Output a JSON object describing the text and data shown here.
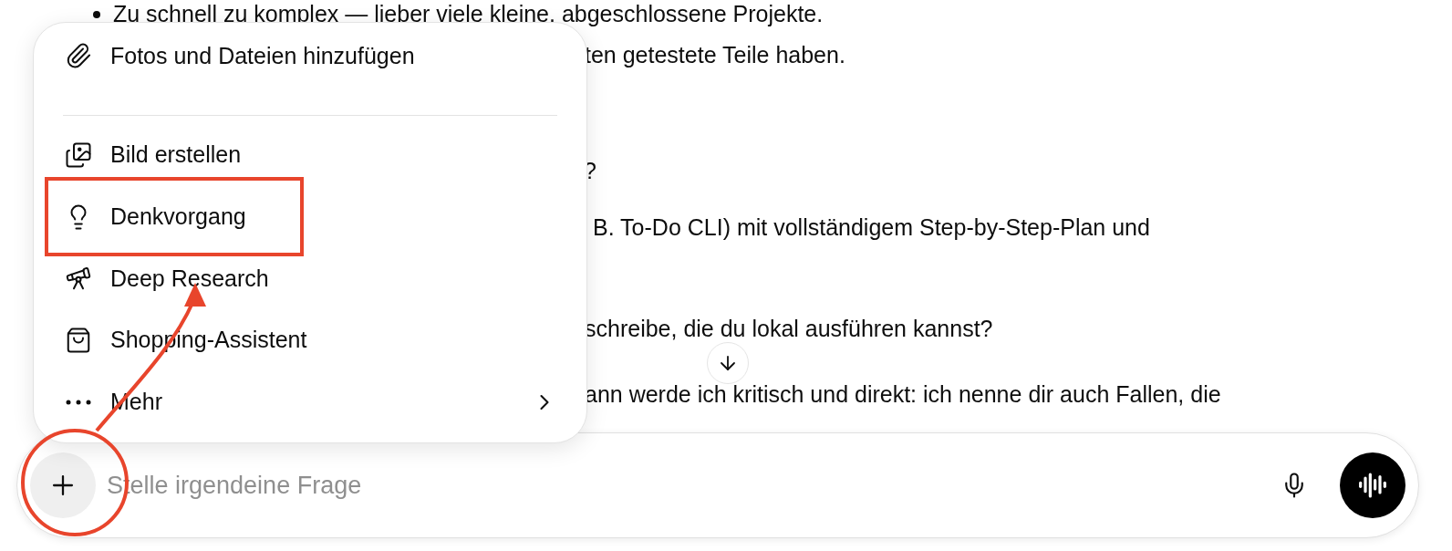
{
  "background_text": [
    {
      "text": "Zu schnell zu komplex — lieber viele kleine, abgeschlossene Projekte.",
      "kind": "bullet"
    },
    {
      "text": "ten getestete Teile haben.",
      "kind": "fragment"
    },
    {
      "text": "?",
      "kind": "fragment"
    },
    {
      "text": "B. To-Do CLI) mit vollständigem Step-by-Step-Plan und",
      "kind": "fragment"
    },
    {
      "text": "schreibe, die du lokal ausführen kannst?",
      "kind": "fragment"
    },
    {
      "text": "ann werde ich kritisch und direkt: ich nenne dir auch Fallen, die",
      "kind": "fragment"
    }
  ],
  "menu": {
    "items": [
      {
        "label": "Fotos und Dateien hinzufügen",
        "kind": "item",
        "annotated": false
      },
      {
        "kind": "divider"
      },
      {
        "label": "Bild erstellen",
        "kind": "item",
        "annotated": false
      },
      {
        "label": "Denkvorgang",
        "kind": "item",
        "annotated": true
      },
      {
        "label": "Deep Research",
        "kind": "item",
        "annotated": false
      },
      {
        "label": "Shopping-Assistent",
        "kind": "item",
        "annotated": false
      },
      {
        "label": "Mehr",
        "kind": "submenu",
        "annotated": false
      }
    ]
  },
  "composer": {
    "placeholder": "Stelle irgendeine Frage",
    "plus_annotated": true
  }
}
